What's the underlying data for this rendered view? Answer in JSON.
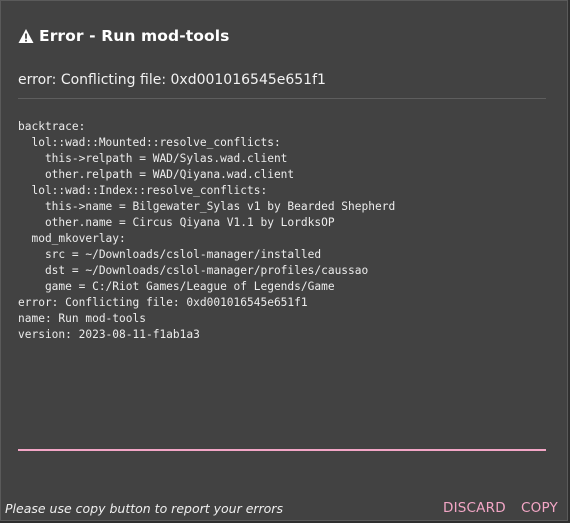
{
  "dialog": {
    "title": "Error - Run mod-tools",
    "title_icon": "warning-icon",
    "message": "error: Conflicting file: 0xd001016545e651f1",
    "log_lines": [
      "backtrace:",
      "  lol::wad::Mounted::resolve_conflicts:",
      "    this->relpath = WAD/Sylas.wad.client",
      "    other.relpath = WAD/Qiyana.wad.client",
      "  lol::wad::Index::resolve_conflicts:",
      "    this->name = Bilgewater_Sylas v1 by Bearded Shepherd",
      "    other.name = Circus Qiyana V1.1 by LordksOP",
      "  mod_mkoverlay:",
      "    src = ~/Downloads/cslol-manager/installed",
      "    dst = ~/Downloads/cslol-manager/profiles/caussao",
      "    game = C:/Riot Games/League of Legends/Game",
      "error: Conflicting file: 0xd001016545e651f1",
      "name: Run mod-tools",
      "version: 2023-08-11-f1ab1a3"
    ],
    "footer_hint": "Please use copy button to report your errors",
    "discard_label": "DISCARD",
    "copy_label": "COPY"
  },
  "colors": {
    "background": "#424242",
    "accent": "#f3a6c6",
    "text": "#ececec"
  }
}
